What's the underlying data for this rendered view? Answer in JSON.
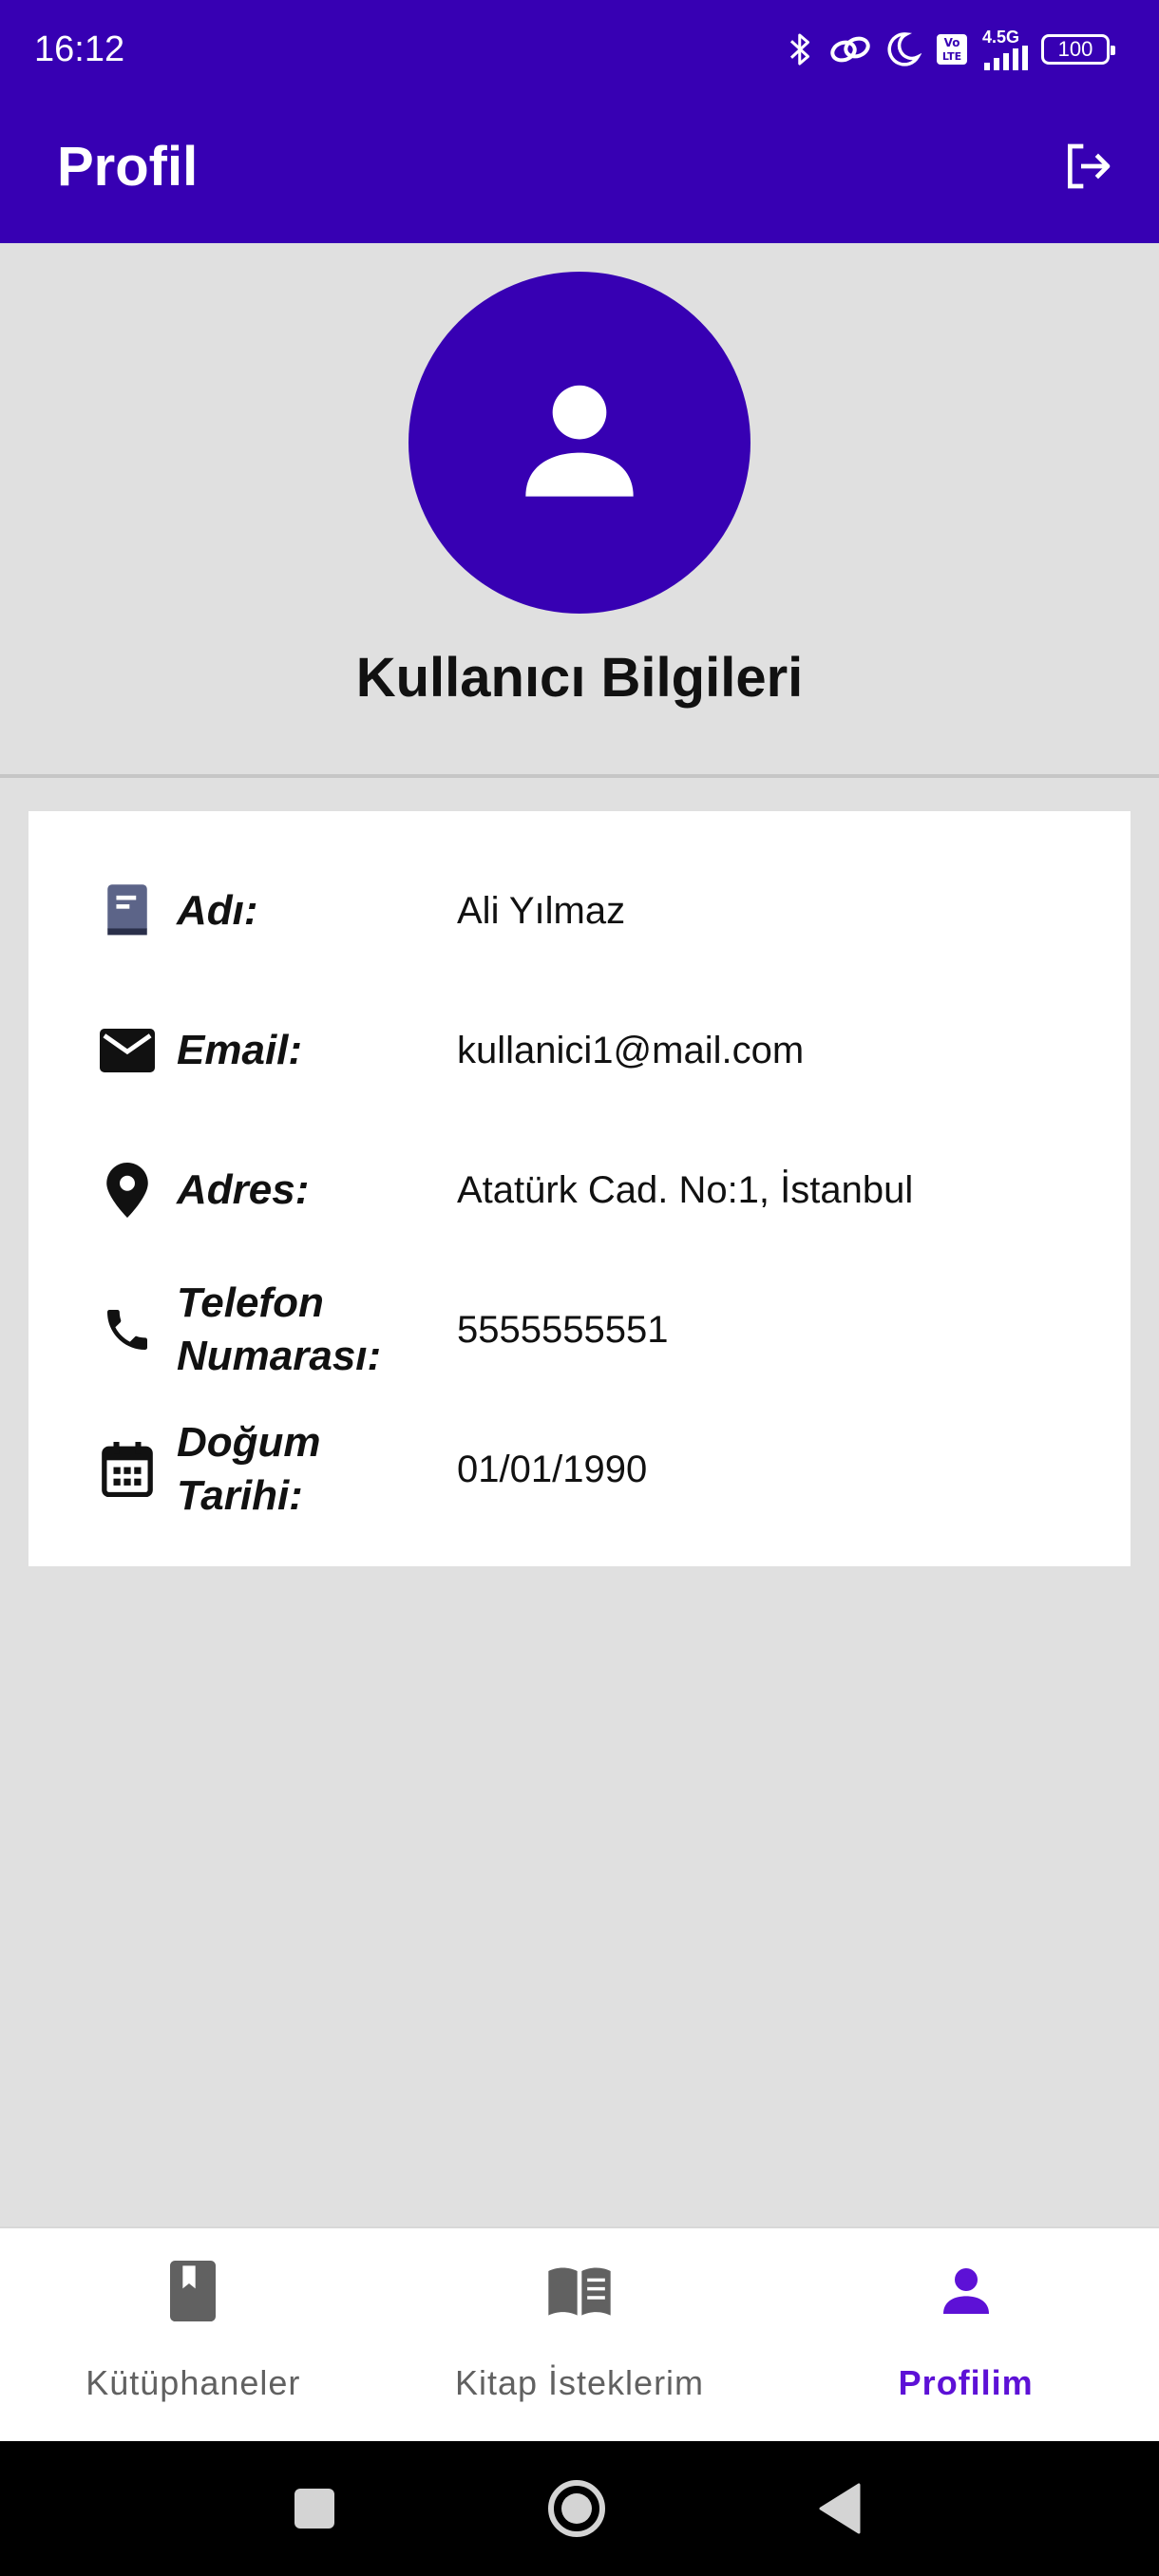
{
  "status_bar": {
    "time": "16:12",
    "network_label": "4.5G",
    "volte_label": "Vo LTE",
    "battery": "100"
  },
  "app_bar": {
    "title": "Profil",
    "logout_icon": "logout-icon",
    "color": "#3700b3"
  },
  "header": {
    "avatar_icon": "person-icon",
    "section_title": "Kullanıcı Bilgileri"
  },
  "user_info": [
    {
      "icon": "book-icon",
      "label": "Adı:",
      "value": "Ali Yılmaz"
    },
    {
      "icon": "mail-icon",
      "label": "Email:",
      "value": "kullanici1@mail.com"
    },
    {
      "icon": "location-pin-icon",
      "label": "Adres:",
      "value": "Atatürk Cad. No:1, İstanbul"
    },
    {
      "icon": "phone-icon",
      "label": "Telefon Numarası:",
      "value": "5555555551"
    },
    {
      "icon": "calendar-icon",
      "label": "Doğum Tarihi:",
      "value": "01/01/1990"
    }
  ],
  "bottom_nav": {
    "active_color": "#5d11d6",
    "items": [
      {
        "label": "Kütüphaneler",
        "icon": "bookmark-book-icon",
        "active": false
      },
      {
        "label": "Kitap İsteklerim",
        "icon": "open-book-icon",
        "active": false
      },
      {
        "label": "Profilim",
        "icon": "person-icon",
        "active": true
      }
    ]
  },
  "system_nav": {
    "recents": "square-icon",
    "home": "circle-icon",
    "back": "triangle-back-icon"
  }
}
